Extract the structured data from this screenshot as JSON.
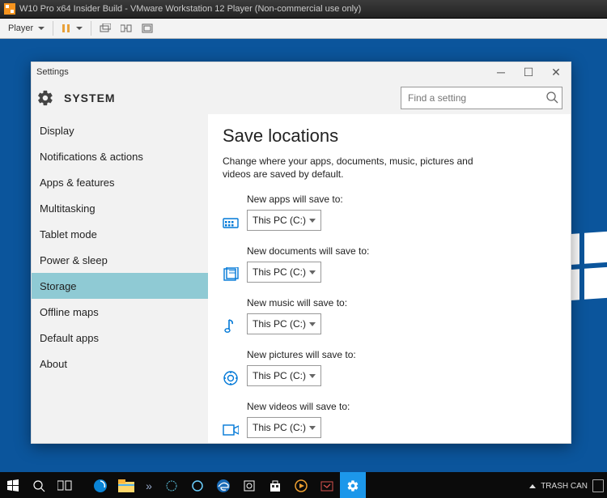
{
  "vm": {
    "title": "W10 Pro x64 Insider Build - VMware Workstation 12 Player (Non-commercial use only)",
    "player_menu": "Player"
  },
  "settings": {
    "titlebar": "Settings",
    "header": "SYSTEM",
    "search_placeholder": "Find a setting",
    "sidebar": {
      "items": [
        {
          "label": "Display"
        },
        {
          "label": "Notifications & actions"
        },
        {
          "label": "Apps & features"
        },
        {
          "label": "Multitasking"
        },
        {
          "label": "Tablet mode"
        },
        {
          "label": "Power & sleep"
        },
        {
          "label": "Storage"
        },
        {
          "label": "Offline maps"
        },
        {
          "label": "Default apps"
        },
        {
          "label": "About"
        }
      ],
      "active_index": 6
    },
    "content": {
      "heading": "Save locations",
      "subtitle": "Change where your apps, documents, music, pictures and videos are saved by default.",
      "rows": [
        {
          "label": "New apps will save to:",
          "value": "This PC (C:)",
          "icon": "apps"
        },
        {
          "label": "New documents will save to:",
          "value": "This PC (C:)",
          "icon": "docs"
        },
        {
          "label": "New music will save to:",
          "value": "This PC (C:)",
          "icon": "music"
        },
        {
          "label": "New pictures will save to:",
          "value": "This PC (C:)",
          "icon": "pictures"
        },
        {
          "label": "New videos will save to:",
          "value": "This PC (C:)",
          "icon": "video"
        }
      ]
    }
  },
  "taskbar": {
    "tray_label": "TRASH CAN"
  }
}
